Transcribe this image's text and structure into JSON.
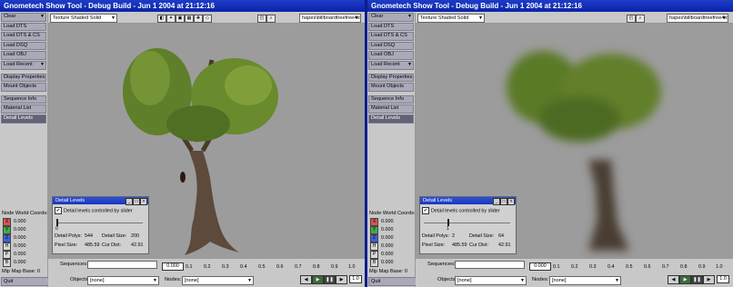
{
  "left": {
    "title": "Gnometech Show Tool - Debug Build - Jun  1 2004 at 21:12:16",
    "render_mode": "Texture Shaded Solid",
    "shape_file": "hapes\\billboardtreefree4.dts",
    "detail": {
      "detail_polys_label": "Detail Polys:",
      "detail_polys": "544",
      "detail_size_label": "Detail Size:",
      "detail_size": "200",
      "pixel_size_label": "Pixel Size:",
      "pixel_size": "485.59",
      "cur_dist_label": "Cur Dist:",
      "cur_dist": "42.91",
      "slider_value": 0
    }
  },
  "right": {
    "title": "Gnometech Show Tool - Debug Build - Jun  1 2004 at 21:12:16",
    "render_mode": "Texture Shaded Solid",
    "shape_file": "hapes\\billboardtreefree4.dts",
    "detail": {
      "detail_polys_label": "Detail Polys:",
      "detail_polys": "2",
      "detail_size_label": "Detail Size:",
      "detail_size": "64",
      "pixel_size_label": "Pixel Size:",
      "pixel_size": "485.59",
      "cur_dist_label": "Cur Dist:",
      "cur_dist": "42.91",
      "slider_value": 1
    }
  },
  "sidebar": {
    "items": [
      "Clear",
      "Load DTS",
      "Load DTS & CS",
      "Load DSQ",
      "Load OBJ",
      "Load Recent",
      "Display Properties",
      "Mount Objects",
      "Sequence Info",
      "Material List",
      "Detail Levels"
    ],
    "node_coords_label": "Node World Coords:",
    "coords": [
      {
        "axis": "X",
        "value": "0.000",
        "color": "#e05050"
      },
      {
        "axis": "Y",
        "value": "0.000",
        "color": "#40b040"
      },
      {
        "axis": "Z",
        "value": "0.000",
        "color": "#4060e0"
      },
      {
        "axis": "H",
        "value": "0.000",
        "color": "#d8d8d8"
      },
      {
        "axis": "P",
        "value": "0.000",
        "color": "#d8d8d8"
      },
      {
        "axis": "B",
        "value": "0.000",
        "color": "#d8d8d8"
      }
    ],
    "mip_map_label": "Mip Map Base: 0",
    "quit": "Quit"
  },
  "detail_panel": {
    "title": "Detail Levels",
    "checkbox_label": "Detail levels controlled by slider",
    "slider_zero": "0",
    "slider_one": "1"
  },
  "bottom": {
    "sequences_label": "Sequences:",
    "time_value": "0.000",
    "ticks": [
      "0.1",
      "0.2",
      "0.3",
      "0.4",
      "0.5",
      "0.6",
      "0.7",
      "0.8",
      "0.9",
      "1.0"
    ],
    "objects_label": "Objects:",
    "objects_value": "[none]",
    "nodes_label": "Nodes:",
    "nodes_value": "[none]",
    "speed_value": "1.0"
  },
  "colors": {
    "titlebar": "#1e3cc8",
    "viewport": "#9c9c9c",
    "selected_item": "#626278",
    "foliage": "#6a8c30",
    "trunk": "#5a4a3a"
  }
}
